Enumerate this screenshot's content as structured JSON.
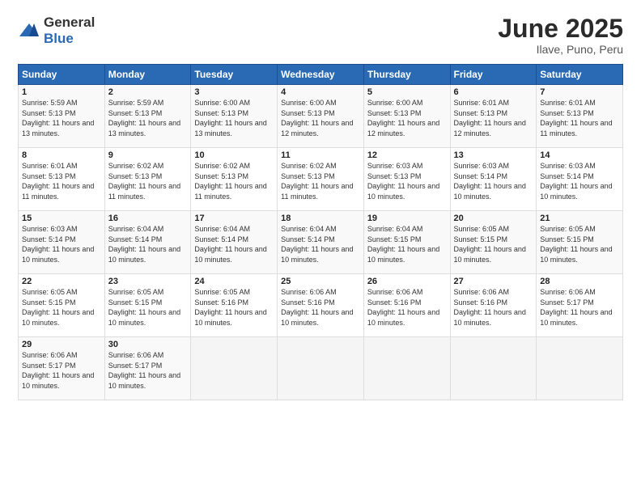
{
  "header": {
    "logo_general": "General",
    "logo_blue": "Blue",
    "title": "June 2025",
    "location": "Ilave, Puno, Peru"
  },
  "days_of_week": [
    "Sunday",
    "Monday",
    "Tuesday",
    "Wednesday",
    "Thursday",
    "Friday",
    "Saturday"
  ],
  "weeks": [
    [
      {
        "day": "1",
        "sunrise": "Sunrise: 5:59 AM",
        "sunset": "Sunset: 5:13 PM",
        "daylight": "Daylight: 11 hours and 13 minutes."
      },
      {
        "day": "2",
        "sunrise": "Sunrise: 5:59 AM",
        "sunset": "Sunset: 5:13 PM",
        "daylight": "Daylight: 11 hours and 13 minutes."
      },
      {
        "day": "3",
        "sunrise": "Sunrise: 6:00 AM",
        "sunset": "Sunset: 5:13 PM",
        "daylight": "Daylight: 11 hours and 13 minutes."
      },
      {
        "day": "4",
        "sunrise": "Sunrise: 6:00 AM",
        "sunset": "Sunset: 5:13 PM",
        "daylight": "Daylight: 11 hours and 12 minutes."
      },
      {
        "day": "5",
        "sunrise": "Sunrise: 6:00 AM",
        "sunset": "Sunset: 5:13 PM",
        "daylight": "Daylight: 11 hours and 12 minutes."
      },
      {
        "day": "6",
        "sunrise": "Sunrise: 6:01 AM",
        "sunset": "Sunset: 5:13 PM",
        "daylight": "Daylight: 11 hours and 12 minutes."
      },
      {
        "day": "7",
        "sunrise": "Sunrise: 6:01 AM",
        "sunset": "Sunset: 5:13 PM",
        "daylight": "Daylight: 11 hours and 11 minutes."
      }
    ],
    [
      {
        "day": "8",
        "sunrise": "Sunrise: 6:01 AM",
        "sunset": "Sunset: 5:13 PM",
        "daylight": "Daylight: 11 hours and 11 minutes."
      },
      {
        "day": "9",
        "sunrise": "Sunrise: 6:02 AM",
        "sunset": "Sunset: 5:13 PM",
        "daylight": "Daylight: 11 hours and 11 minutes."
      },
      {
        "day": "10",
        "sunrise": "Sunrise: 6:02 AM",
        "sunset": "Sunset: 5:13 PM",
        "daylight": "Daylight: 11 hours and 11 minutes."
      },
      {
        "day": "11",
        "sunrise": "Sunrise: 6:02 AM",
        "sunset": "Sunset: 5:13 PM",
        "daylight": "Daylight: 11 hours and 11 minutes."
      },
      {
        "day": "12",
        "sunrise": "Sunrise: 6:03 AM",
        "sunset": "Sunset: 5:13 PM",
        "daylight": "Daylight: 11 hours and 10 minutes."
      },
      {
        "day": "13",
        "sunrise": "Sunrise: 6:03 AM",
        "sunset": "Sunset: 5:14 PM",
        "daylight": "Daylight: 11 hours and 10 minutes."
      },
      {
        "day": "14",
        "sunrise": "Sunrise: 6:03 AM",
        "sunset": "Sunset: 5:14 PM",
        "daylight": "Daylight: 11 hours and 10 minutes."
      }
    ],
    [
      {
        "day": "15",
        "sunrise": "Sunrise: 6:03 AM",
        "sunset": "Sunset: 5:14 PM",
        "daylight": "Daylight: 11 hours and 10 minutes."
      },
      {
        "day": "16",
        "sunrise": "Sunrise: 6:04 AM",
        "sunset": "Sunset: 5:14 PM",
        "daylight": "Daylight: 11 hours and 10 minutes."
      },
      {
        "day": "17",
        "sunrise": "Sunrise: 6:04 AM",
        "sunset": "Sunset: 5:14 PM",
        "daylight": "Daylight: 11 hours and 10 minutes."
      },
      {
        "day": "18",
        "sunrise": "Sunrise: 6:04 AM",
        "sunset": "Sunset: 5:14 PM",
        "daylight": "Daylight: 11 hours and 10 minutes."
      },
      {
        "day": "19",
        "sunrise": "Sunrise: 6:04 AM",
        "sunset": "Sunset: 5:15 PM",
        "daylight": "Daylight: 11 hours and 10 minutes."
      },
      {
        "day": "20",
        "sunrise": "Sunrise: 6:05 AM",
        "sunset": "Sunset: 5:15 PM",
        "daylight": "Daylight: 11 hours and 10 minutes."
      },
      {
        "day": "21",
        "sunrise": "Sunrise: 6:05 AM",
        "sunset": "Sunset: 5:15 PM",
        "daylight": "Daylight: 11 hours and 10 minutes."
      }
    ],
    [
      {
        "day": "22",
        "sunrise": "Sunrise: 6:05 AM",
        "sunset": "Sunset: 5:15 PM",
        "daylight": "Daylight: 11 hours and 10 minutes."
      },
      {
        "day": "23",
        "sunrise": "Sunrise: 6:05 AM",
        "sunset": "Sunset: 5:15 PM",
        "daylight": "Daylight: 11 hours and 10 minutes."
      },
      {
        "day": "24",
        "sunrise": "Sunrise: 6:05 AM",
        "sunset": "Sunset: 5:16 PM",
        "daylight": "Daylight: 11 hours and 10 minutes."
      },
      {
        "day": "25",
        "sunrise": "Sunrise: 6:06 AM",
        "sunset": "Sunset: 5:16 PM",
        "daylight": "Daylight: 11 hours and 10 minutes."
      },
      {
        "day": "26",
        "sunrise": "Sunrise: 6:06 AM",
        "sunset": "Sunset: 5:16 PM",
        "daylight": "Daylight: 11 hours and 10 minutes."
      },
      {
        "day": "27",
        "sunrise": "Sunrise: 6:06 AM",
        "sunset": "Sunset: 5:16 PM",
        "daylight": "Daylight: 11 hours and 10 minutes."
      },
      {
        "day": "28",
        "sunrise": "Sunrise: 6:06 AM",
        "sunset": "Sunset: 5:17 PM",
        "daylight": "Daylight: 11 hours and 10 minutes."
      }
    ],
    [
      {
        "day": "29",
        "sunrise": "Sunrise: 6:06 AM",
        "sunset": "Sunset: 5:17 PM",
        "daylight": "Daylight: 11 hours and 10 minutes."
      },
      {
        "day": "30",
        "sunrise": "Sunrise: 6:06 AM",
        "sunset": "Sunset: 5:17 PM",
        "daylight": "Daylight: 11 hours and 10 minutes."
      },
      null,
      null,
      null,
      null,
      null
    ]
  ]
}
